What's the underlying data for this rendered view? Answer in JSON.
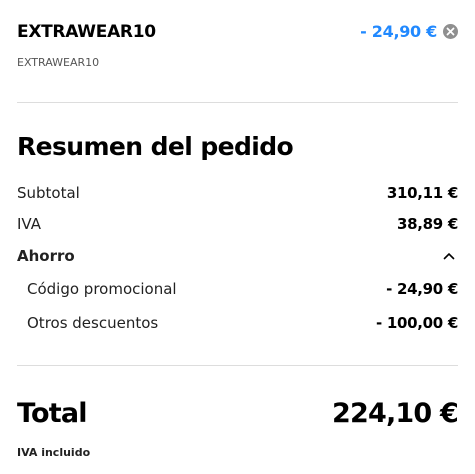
{
  "coupon": {
    "code": "EXTRAWEAR10",
    "code_subtitle": "EXTRAWEAR10",
    "amount": "- 24,90 €",
    "remove_icon": "close-circle-icon",
    "accent_color": "#2189ff"
  },
  "summary": {
    "title": "Resumen del pedido",
    "rows": [
      {
        "label": "Subtotal",
        "value": "310,11 €"
      },
      {
        "label": "IVA",
        "value": "38,89 €"
      }
    ],
    "savings": {
      "label": "Ahorro",
      "toggle_icon": "chevron-up-icon",
      "expanded": true,
      "items": [
        {
          "label": "Código promocional",
          "value": "- 24,90 €"
        },
        {
          "label": "Otros descuentos",
          "value": "- 100,00 €"
        }
      ]
    },
    "total": {
      "label": "Total",
      "value": "224,10 €",
      "note": "IVA incluido"
    }
  }
}
